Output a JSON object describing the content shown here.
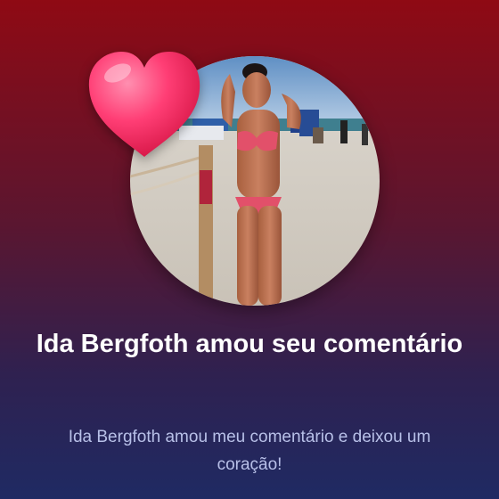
{
  "notification": {
    "title": "Ida Bergfoth amou seu comentário",
    "message": "Ida Bergfoth amou meu comentário e deixou um coração!"
  },
  "colors": {
    "background_top": "#8f0a14",
    "background_bottom": "#1f2a63",
    "title_text": "#ffffff",
    "message_text": "#b8c0e8",
    "heart": "#ff2f6e"
  },
  "icons": {
    "reaction": "heart-icon"
  }
}
